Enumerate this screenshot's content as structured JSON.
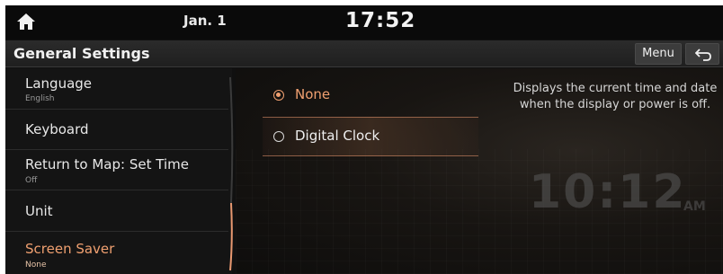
{
  "statusbar": {
    "date": "Jan. 1",
    "time": "17:52",
    "home_icon": "home-icon"
  },
  "titlebar": {
    "title": "General Settings",
    "menu_label": "Menu",
    "back_icon": "back-arrow-icon"
  },
  "sidebar": {
    "items": [
      {
        "label": "Language",
        "sub": "English",
        "active": false
      },
      {
        "label": "Keyboard",
        "sub": "",
        "active": false
      },
      {
        "label": "Return to Map: Set Time",
        "sub": "Off",
        "active": false
      },
      {
        "label": "Unit",
        "sub": "",
        "active": false
      },
      {
        "label": "Screen Saver",
        "sub": "None",
        "active": true
      }
    ]
  },
  "options": [
    {
      "label": "None",
      "selected": true
    },
    {
      "label": "Digital Clock",
      "selected": false
    }
  ],
  "description": "Displays the current time and date when the display or power is off.",
  "preview": {
    "time": "10:12",
    "ampm": "AM"
  },
  "colors": {
    "accent": "#f0a070",
    "background": "#101010"
  }
}
